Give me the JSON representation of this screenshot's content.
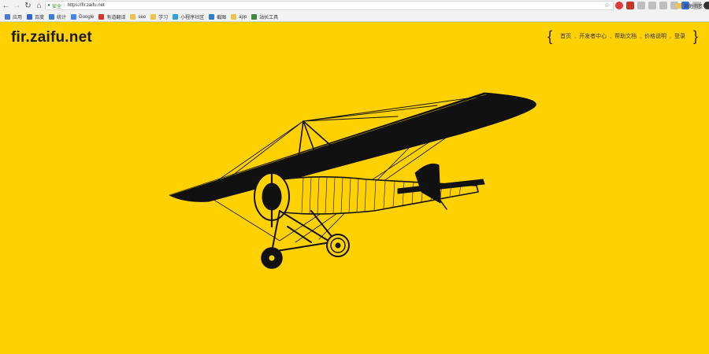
{
  "browser": {
    "nav": {
      "back_icon": "arrow-left-icon",
      "forward_icon": "arrow-right-icon",
      "reload_icon": "reload-icon",
      "home_icon": "home-icon"
    },
    "address": {
      "secure_label": "安全",
      "url": "https://fir.zaifu.net"
    },
    "bookmarks": [
      {
        "label": "应用",
        "icon": "apps-grid-icon",
        "color": "#4a7bd0"
      },
      {
        "label": "百度",
        "icon": "baidu-icon",
        "color": "#3366cc"
      },
      {
        "label": "统计",
        "icon": "stats-icon",
        "color": "#3b7dd8"
      },
      {
        "label": "Google",
        "icon": "google-icon",
        "color": "#4285f4"
      },
      {
        "label": "有道翻译",
        "icon": "youdao-icon",
        "color": "#d8332b"
      },
      {
        "label": "seo",
        "icon": "folder-icon",
        "color": "#f0c24b"
      },
      {
        "label": "学习",
        "icon": "folder-icon",
        "color": "#f0c24b"
      },
      {
        "label": "小程序社区",
        "icon": "mini-program-icon",
        "color": "#2aa3df"
      },
      {
        "label": "截图",
        "icon": "screenshot-icon",
        "color": "#2a7fd0"
      },
      {
        "label": "app",
        "icon": "folder-icon",
        "color": "#f0c24b"
      },
      {
        "label": "站长工具",
        "icon": "webmaster-icon",
        "color": "#3c8a3c"
      }
    ],
    "other_bookmarks": "其他书签"
  },
  "site": {
    "title": "fir.zaifu.net",
    "nav": {
      "open_brace": "{",
      "close_brace": "}",
      "items": [
        "首页",
        "开发者中心",
        "帮助文档",
        "价格说明",
        "登录"
      ]
    }
  },
  "colors": {
    "background": "#ffd100",
    "ink": "#111111"
  }
}
